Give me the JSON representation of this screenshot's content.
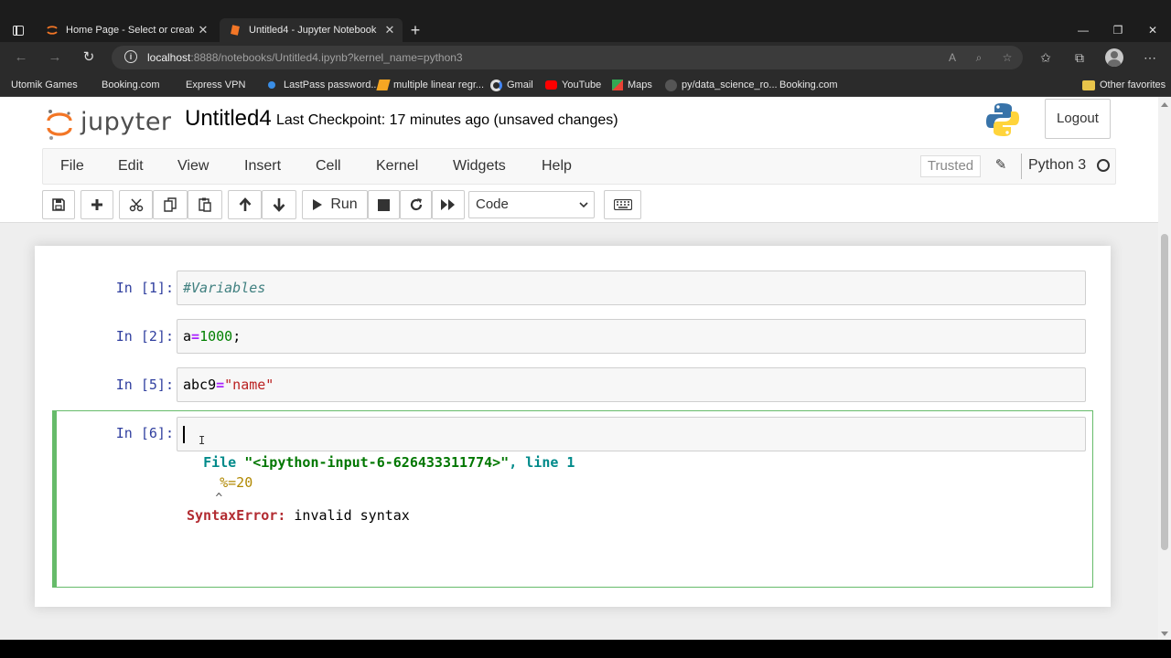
{
  "browser": {
    "tabs": [
      {
        "title": "Home Page - Select or create a notebook",
        "icon": "jupyter-icon"
      },
      {
        "title": "Untitled4 - Jupyter Notebook",
        "icon": "notebook-icon"
      }
    ],
    "url_host": "localhost",
    "url_rest": ":8888/notebooks/Untitled4.ipynb?kernel_name=python3",
    "bookmarks": [
      {
        "label": "Utomik Games",
        "icon": "page-icon"
      },
      {
        "label": "Booking.com",
        "icon": "page-icon"
      },
      {
        "label": "Express VPN",
        "icon": "page-icon"
      },
      {
        "label": "LastPass password...",
        "icon": "lastpass-icon"
      },
      {
        "label": "multiple linear regr...",
        "icon": "favicon-icon"
      },
      {
        "label": "Gmail",
        "icon": "google-icon"
      },
      {
        "label": "YouTube",
        "icon": "youtube-icon"
      },
      {
        "label": "Maps",
        "icon": "maps-icon"
      },
      {
        "label": "py/data_science_ro...",
        "icon": "github-icon"
      },
      {
        "label": "Booking.com",
        "icon": "page-icon"
      }
    ],
    "other_favorites": "Other favorites"
  },
  "header": {
    "logo_text": "jupyter",
    "notebook_name": "Untitled4",
    "checkpoint": "Last Checkpoint: 17 minutes ago   (unsaved changes)",
    "logout": "Logout"
  },
  "menu": {
    "items": [
      "File",
      "Edit",
      "View",
      "Insert",
      "Cell",
      "Kernel",
      "Widgets",
      "Help"
    ],
    "trusted": "Trusted",
    "kernel": "Python 3"
  },
  "toolbar": {
    "run_label": "Run",
    "cell_type": "Code"
  },
  "cells": [
    {
      "prompt": "In [1]:",
      "code": "#Variables"
    },
    {
      "prompt": "In [2]:",
      "code_var": "a",
      "code_op": "=",
      "code_num": "1000",
      "code_tail": ";"
    },
    {
      "prompt": "In [5]:",
      "code_var": "abc9",
      "code_op": "=",
      "code_str": "\"name\""
    },
    {
      "prompt": "In [6]:",
      "code": ""
    }
  ],
  "output": {
    "file_kw": "File",
    "file_path": "\"<ipython-input-6-626433311774>\"",
    "line_info": ", line 1",
    "code_line": "%=20",
    "caret": "^",
    "error_name": "SyntaxError:",
    "error_msg": " invalid syntax"
  },
  "colors": {
    "selected_cell_border": "#66bb6a",
    "prompt": "#303f9f"
  }
}
